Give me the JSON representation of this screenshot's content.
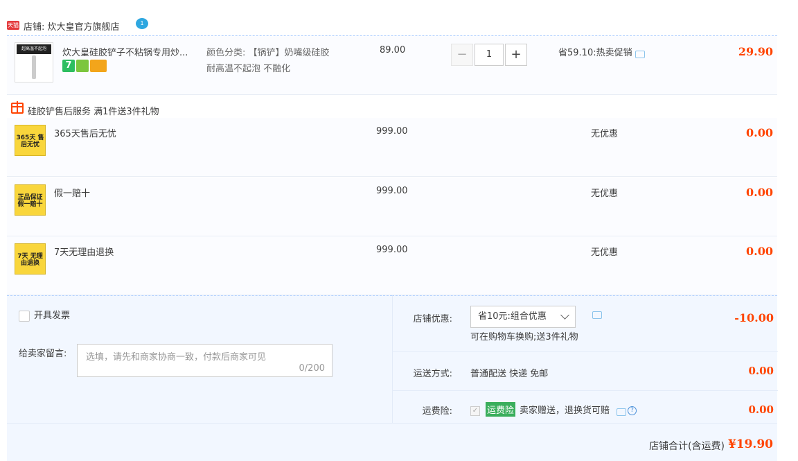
{
  "shop": {
    "badge": "天猫",
    "name": "店铺: 炊大皇官方旗舰店",
    "ww_badge": "1"
  },
  "main_item": {
    "title": "炊大皇硅胶铲子不粘锅专用炒...",
    "thumb_caption": "超高温不起泡",
    "service_icon_7": "7",
    "sku_line1": "颜色分类: 【锅铲】奶嘴级硅胶",
    "sku_line2": "耐高温不起泡 不融化",
    "unit_price": "89.00",
    "minus": "−",
    "quantity": "1",
    "plus": "+",
    "promo": "省59.10:热卖促销",
    "total": "29.90"
  },
  "gift_header": {
    "text": "硅胶铲售后服务  满1件送3件礼物"
  },
  "gifts": [
    {
      "thumb": "365天 售后无忧",
      "title": "365天售后无忧",
      "price": "999.00",
      "promo": "无优惠",
      "total": "0.00"
    },
    {
      "thumb": "正品保证 假一赔十",
      "title": "假一赔十",
      "price": "999.00",
      "promo": "无优惠",
      "total": "0.00"
    },
    {
      "thumb": "7天 无理由退换",
      "title": "7天无理由退换",
      "price": "999.00",
      "promo": "无优惠",
      "total": "0.00"
    }
  ],
  "invoice": {
    "label": "开具发票"
  },
  "message": {
    "label": "给卖家留言:",
    "placeholder": "选填，请先和商家协商一致，付款后商家可见",
    "count": "0/200"
  },
  "shop_discount": {
    "label": "店铺优惠:",
    "selected": "省10元:组合优惠",
    "note": "可在购物车换购;送3件礼物",
    "amount": "-10.00"
  },
  "shipping": {
    "label": "运送方式:",
    "value": "普通配送 快递 免邮",
    "amount": "0.00"
  },
  "insurance": {
    "label": "运费险:",
    "badge": "运费险",
    "text": "卖家赠送，退换货可赔",
    "help": "?",
    "amount": "0.00"
  },
  "shop_total": {
    "label": "店铺合计(含运费)",
    "amount": "¥19.90"
  },
  "colors": {
    "price_red": "#ff4400",
    "row_bg": "#fbfcff",
    "panel_bg": "#f2f7ff",
    "insurance_green": "#3aae5c"
  }
}
